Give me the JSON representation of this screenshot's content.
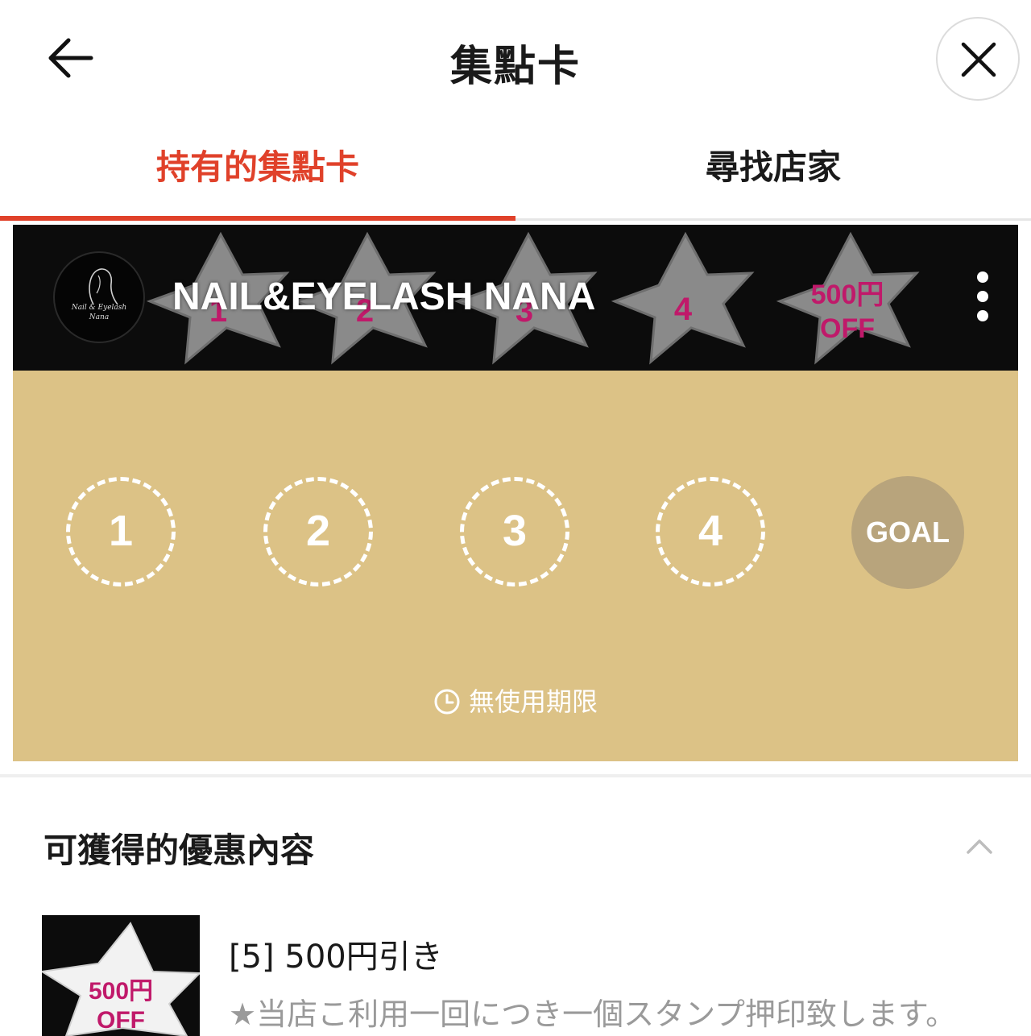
{
  "header": {
    "title": "集點卡",
    "back_icon": "arrow-left-icon",
    "close_icon": "close-icon"
  },
  "tabs": [
    {
      "label": "持有的集點卡",
      "active": true
    },
    {
      "label": "尋找店家",
      "active": false
    }
  ],
  "card": {
    "shop_name": "NAIL&EYELASH NANA",
    "logo_text_line1": "Nail & Eyelash",
    "logo_text_line2": "Nana",
    "banner_labels": [
      "1",
      "2",
      "3",
      "4",
      "500円",
      "OFF"
    ],
    "stamps": [
      "1",
      "2",
      "3",
      "4"
    ],
    "goal_label": "GOAL",
    "expiry": "無使用期限",
    "colors": {
      "card_body": "#dcc286",
      "goal": "#b8a47c",
      "accent": "#e0412a",
      "banner_label": "#c0196a"
    }
  },
  "rewards": {
    "section_title": "可獲得的優惠內容",
    "items": [
      {
        "thumb_line1": "500円",
        "thumb_line2": "OFF",
        "title": "[5] 500円引き",
        "description": "★当店こ利用一回につき一個スタンプ押印致します。"
      }
    ]
  }
}
